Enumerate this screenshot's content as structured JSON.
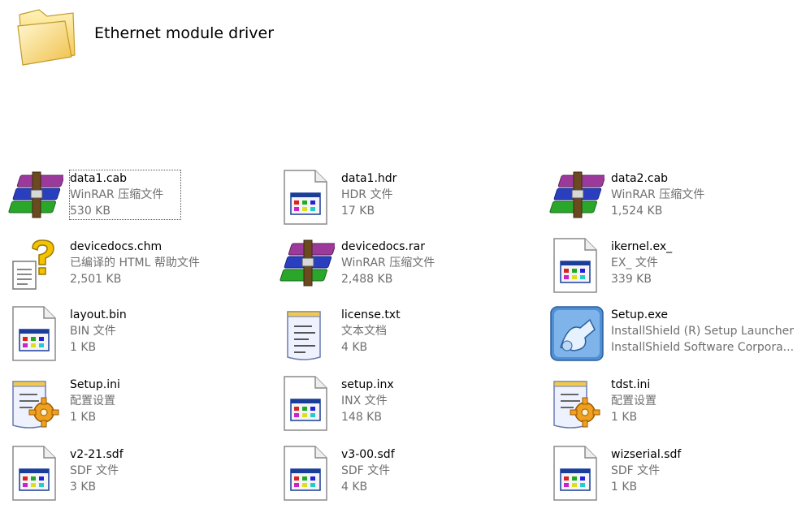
{
  "folder": {
    "title": "Ethernet module driver",
    "icon": "folder-icon"
  },
  "files": [
    {
      "name": "data1.cab",
      "desc": "WinRAR 压缩文件",
      "size": "530 KB",
      "icon": "winrar-archive-icon",
      "selected": true
    },
    {
      "name": "data1.hdr",
      "desc": "HDR 文件",
      "size": "17 KB",
      "icon": "generic-file-icon"
    },
    {
      "name": "data2.cab",
      "desc": "WinRAR 压缩文件",
      "size": "1,524 KB",
      "icon": "winrar-archive-icon"
    },
    {
      "name": "devicedocs.chm",
      "desc": "已编译的 HTML 帮助文件",
      "size": "2,501 KB",
      "icon": "help-file-icon"
    },
    {
      "name": "devicedocs.rar",
      "desc": "WinRAR 压缩文件",
      "size": "2,488 KB",
      "icon": "winrar-archive-icon"
    },
    {
      "name": "ikernel.ex_",
      "desc": "EX_ 文件",
      "size": "339 KB",
      "icon": "generic-file-icon"
    },
    {
      "name": "layout.bin",
      "desc": "BIN 文件",
      "size": "1 KB",
      "icon": "generic-file-icon"
    },
    {
      "name": "license.txt",
      "desc": "文本文档",
      "size": "4 KB",
      "icon": "text-document-icon"
    },
    {
      "name": "Setup.exe",
      "desc": "InstallShield (R) Setup Launcher",
      "size": "InstallShield Software Corpora...",
      "icon": "installshield-setup-icon"
    },
    {
      "name": "Setup.ini",
      "desc": "配置设置",
      "size": "1 KB",
      "icon": "config-settings-icon"
    },
    {
      "name": "setup.inx",
      "desc": "INX 文件",
      "size": "148 KB",
      "icon": "generic-file-icon"
    },
    {
      "name": "tdst.ini",
      "desc": "配置设置",
      "size": "1 KB",
      "icon": "config-settings-icon"
    },
    {
      "name": "v2-21.sdf",
      "desc": "SDF 文件",
      "size": "3 KB",
      "icon": "generic-file-icon"
    },
    {
      "name": "v3-00.sdf",
      "desc": "SDF 文件",
      "size": "4 KB",
      "icon": "generic-file-icon"
    },
    {
      "name": "wizserial.sdf",
      "desc": "SDF 文件",
      "size": "1 KB",
      "icon": "generic-file-icon"
    }
  ]
}
